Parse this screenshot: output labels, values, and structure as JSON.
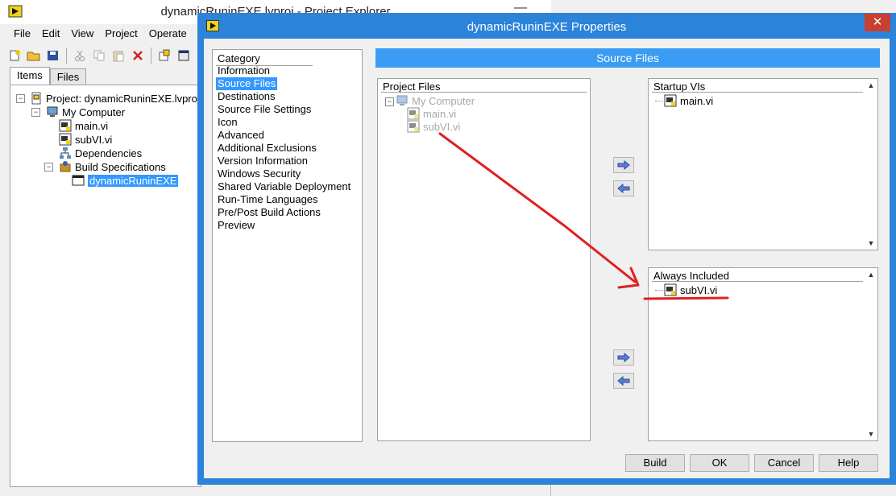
{
  "project_explorer": {
    "title": "dynamicRuninEXE.lvproj - Project Explorer",
    "minimize_glyph": "—",
    "menu": [
      "File",
      "Edit",
      "View",
      "Project",
      "Operate"
    ],
    "tabs": [
      "Items",
      "Files"
    ],
    "toolbar_icons": [
      "new-icon",
      "open-icon",
      "save-all-icon",
      "cut-icon",
      "copy-icon",
      "paste-icon",
      "delete-icon",
      "build-icon",
      "properties-icon"
    ],
    "tree": {
      "project": "Project: dynamicRuninEXE.lvproj",
      "computer": "My Computer",
      "items": [
        "main.vi",
        "subVI.vi"
      ],
      "dependencies": "Dependencies",
      "build_specs": "Build Specifications",
      "build_item": "dynamicRuninEXE"
    }
  },
  "dialog": {
    "title": "dynamicRuninEXE Properties",
    "close_glyph": "✕",
    "category_label": "Category",
    "categories": [
      "Information",
      "Source Files",
      "Destinations",
      "Source File Settings",
      "Icon",
      "Advanced",
      "Additional Exclusions",
      "Version Information",
      "Windows Security",
      "Shared Variable Deployment",
      "Run-Time Languages",
      "Pre/Post Build Actions",
      "Preview"
    ],
    "selected_category": "Source Files",
    "header": "Source Files",
    "project_files": {
      "label": "Project Files",
      "computer": "My Computer",
      "items": [
        "main.vi",
        "subVI.vi"
      ]
    },
    "startup_vis": {
      "label": "Startup VIs",
      "items": [
        "main.vi"
      ]
    },
    "always_included": {
      "label": "Always Included",
      "items": [
        "subVI.vi"
      ]
    },
    "buttons": {
      "build": "Build",
      "ok": "OK",
      "cancel": "Cancel",
      "help": "Help"
    }
  },
  "colors": {
    "dialog_frame": "#2b83da",
    "header_bar": "#3a9cf2",
    "selection": "#3399ff",
    "annotation": "#e02020"
  }
}
